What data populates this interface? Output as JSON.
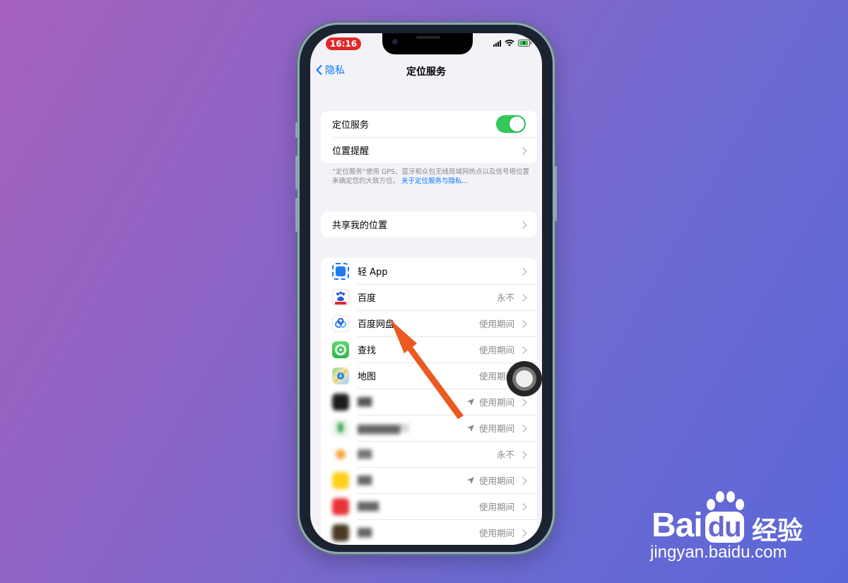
{
  "status_bar": {
    "time": "16:16"
  },
  "nav": {
    "back_label": "隐私",
    "title": "定位服务"
  },
  "section1": {
    "location_services_label": "定位服务",
    "location_services_on": true,
    "location_alerts_label": "位置提醒"
  },
  "footnote": {
    "text": "“定位服务”使用 GPS、蓝牙和众包无线局域网热点以及信号塔位置来确定您的大致方位。",
    "link": "关于定位服务与隐私..."
  },
  "section2": {
    "share_location_label": "共享我的位置"
  },
  "apps": [
    {
      "name": "轻 App",
      "status": "",
      "icon": "light-app-icon",
      "color": "#1e7cf2",
      "blurred": false,
      "nav_arrow": false
    },
    {
      "name": "百度",
      "status": "永不",
      "icon": "baidu-icon",
      "color": "#2b56d9",
      "blurred": false,
      "nav_arrow": false
    },
    {
      "name": "百度网盘",
      "status": "使用期间",
      "icon": "baidu-netdisk-icon",
      "color": "#ffffff",
      "blurred": false,
      "nav_arrow": false
    },
    {
      "name": "查找",
      "status": "使用期间",
      "icon": "find-my-icon",
      "color": "#3cc35b",
      "blurred": false,
      "nav_arrow": false
    },
    {
      "name": "地图",
      "status": "使用期间",
      "icon": "maps-icon",
      "color": "#66b6e8",
      "blurred": false,
      "nav_arrow": false
    },
    {
      "name": "",
      "status": "使用期间",
      "icon": "tiktok-icon",
      "color": "#1b1b1b",
      "blurred": true,
      "nav_arrow": true
    },
    {
      "name": "",
      "status": "使用期间",
      "icon": "bank-icon",
      "color": "#3fa04a",
      "blurred": true,
      "nav_arrow": true
    },
    {
      "name": "",
      "status": "永不",
      "icon": "app-orange-icon",
      "color": "#f7a53c",
      "blurred": true,
      "nav_arrow": false
    },
    {
      "name": "",
      "status": "使用期间",
      "icon": "meituan-icon",
      "color": "#ffcf1a",
      "blurred": true,
      "nav_arrow": true
    },
    {
      "name": "",
      "status": "使用期间",
      "icon": "pinduoduo-icon",
      "color": "#e8323a",
      "blurred": true,
      "nav_arrow": false
    },
    {
      "name": "",
      "status": "使用期间",
      "icon": "app-brown-icon",
      "color": "#4a3a24",
      "blurred": true,
      "nav_arrow": false
    }
  ],
  "watermark": {
    "logo": "Bai",
    "logo_tail": "du",
    "cn": "经验",
    "url": "jingyan.baidu.com"
  }
}
